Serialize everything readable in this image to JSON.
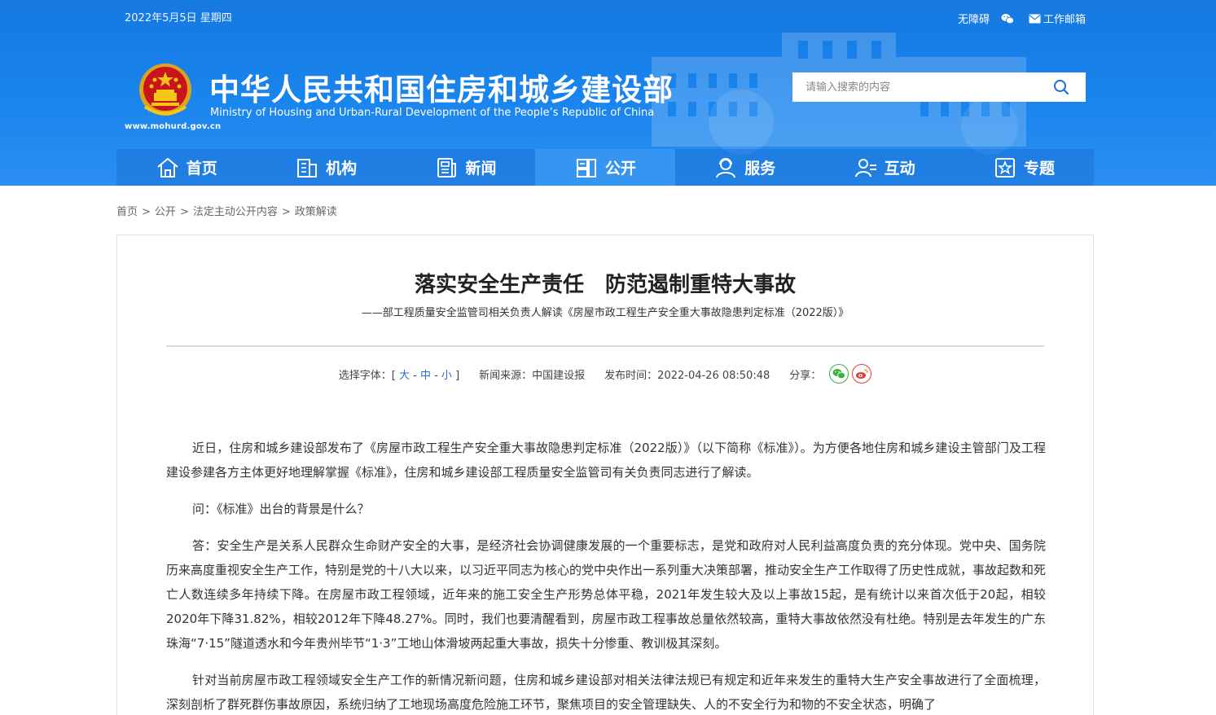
{
  "header": {
    "date": "2022年5月5日 星期四",
    "accessible": "无障碍",
    "mail": "工作邮箱",
    "site_title": "中华人民共和国住房和城乡建设部",
    "site_subtitle": "Ministry of Housing and Urban-Rural Development of the People’s Republic of China",
    "site_url": "www.mohurd.gov.cn",
    "search_placeholder": "请输入搜索的内容"
  },
  "nav": [
    {
      "label": "首页",
      "icon": "home-icon"
    },
    {
      "label": "机构",
      "icon": "building-icon"
    },
    {
      "label": "新闻",
      "icon": "news-icon"
    },
    {
      "label": "公开",
      "icon": "disclosure-icon",
      "active": true
    },
    {
      "label": "服务",
      "icon": "service-icon"
    },
    {
      "label": "互动",
      "icon": "interaction-icon"
    },
    {
      "label": "专题",
      "icon": "topic-star-icon"
    }
  ],
  "breadcrumb": [
    "首页",
    "公开",
    "法定主动公开内容",
    "政策解读"
  ],
  "article": {
    "title": "落实安全生产责任　防范遏制重特大事故",
    "subtitle": "——部工程质量安全监管司相关负责人解读《房屋市政工程生产安全重大事故隐患判定标准（2022版）》",
    "font_label": "选择字体：",
    "font_large": "大",
    "font_medium": "中",
    "font_small": "小",
    "source": "新闻来源：中国建设报",
    "publish_time": "发布时间：2022-04-26 08:50:48",
    "share_label": "分享：",
    "paragraphs": [
      "近日，住房和城乡建设部发布了《房屋市政工程生产安全重大事故隐患判定标准（2022版）》（以下简称《标准》）。为方便各地住房和城乡建设主管部门及工程建设参建各方主体更好地理解掌握《标准》，住房和城乡建设部工程质量安全监管司有关负责同志进行了解读。",
      "问：《标准》出台的背景是什么？",
      "答：安全生产是关系人民群众生命财产安全的大事，是经济社会协调健康发展的一个重要标志，是党和政府对人民利益高度负责的充分体现。党中央、国务院历来高度重视安全生产工作，特别是党的十八大以来，以习近平同志为核心的党中央作出一系列重大决策部署，推动安全生产工作取得了历史性成就，事故起数和死亡人数连续多年持续下降。在房屋市政工程领域，近年来的施工安全生产形势总体平稳，2021年发生较大及以上事故15起，是有统计以来首次低于20起，相较2020年下降31.82%，相较2012年下降48.27%。同时，我们也要清醒看到，房屋市政工程事故总量依然较高，重特大事故依然没有杜绝。特别是去年发生的广东珠海“7·15”隧道透水和今年贵州毕节“1·3”工地山体滑坡两起重大事故，损失十分惨重、教训极其深刻。",
      "针对当前房屋市政工程领域安全生产工作的新情况新问题，住房和城乡建设部对相关法律法规已有规定和近年来发生的重特大生产安全事故进行了全面梳理，深刻剖析了群死群伤事故原因，系统归纳了工地现场高度危险施工环节，聚焦项目的安全管理缺失、人的不安全行为和物的不安全状态，明确了"
    ]
  }
}
